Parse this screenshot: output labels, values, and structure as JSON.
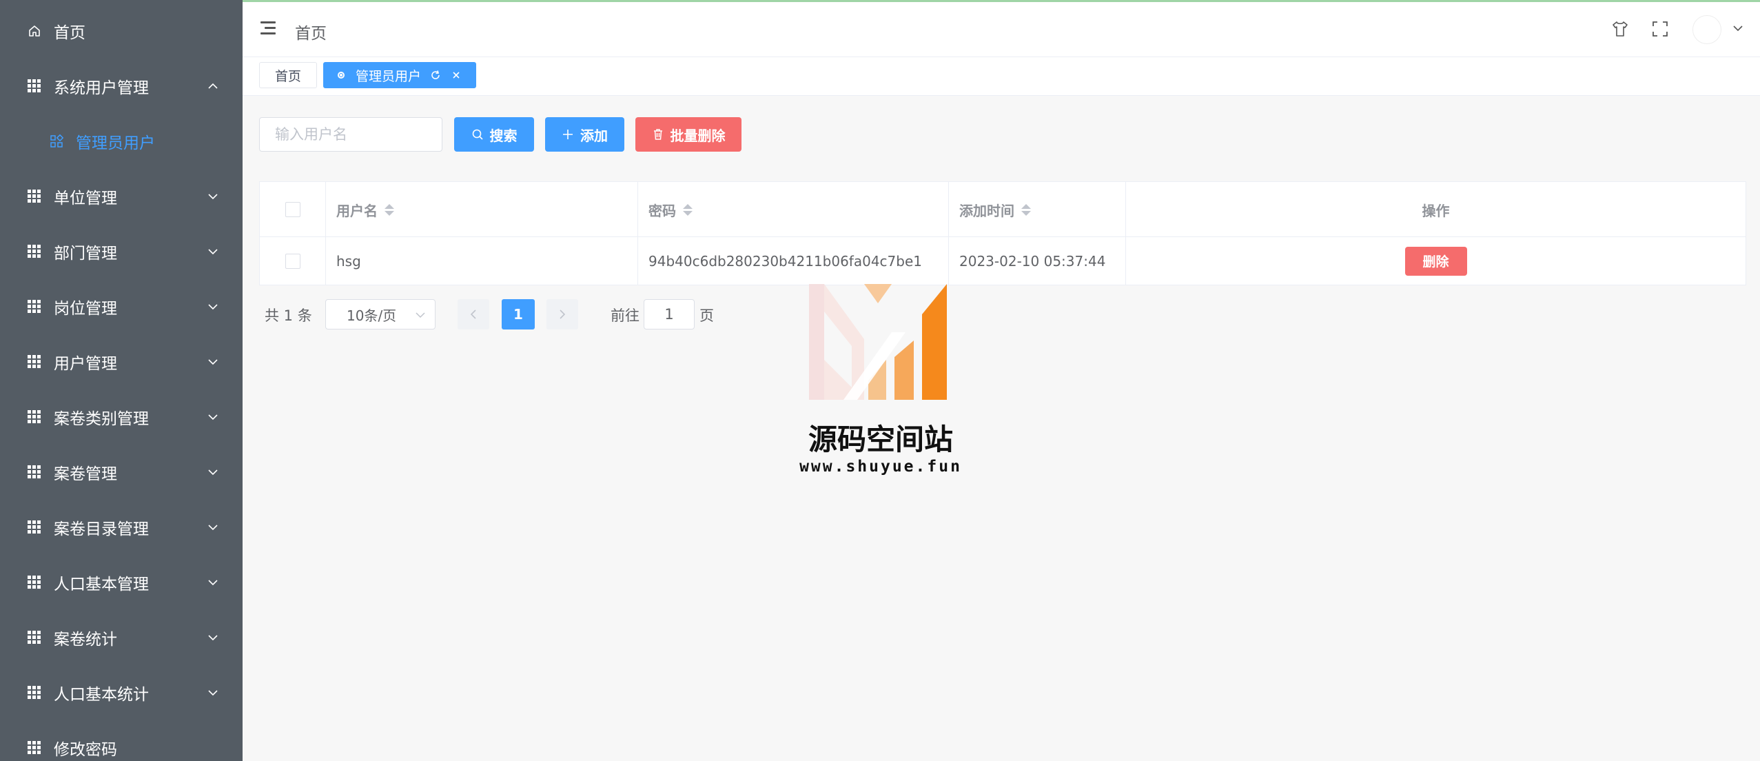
{
  "sidebar": {
    "items": [
      {
        "label": "首页",
        "icon": "home-icon"
      },
      {
        "label": "系统用户管理",
        "icon": "grid-icon",
        "expanded": true
      },
      {
        "label": "管理员用户",
        "icon": "apps-icon",
        "active": true
      },
      {
        "label": "单位管理",
        "icon": "grid-icon"
      },
      {
        "label": "部门管理",
        "icon": "grid-icon"
      },
      {
        "label": "岗位管理",
        "icon": "grid-icon"
      },
      {
        "label": "用户管理",
        "icon": "grid-icon"
      },
      {
        "label": "案卷类别管理",
        "icon": "grid-icon"
      },
      {
        "label": "案卷管理",
        "icon": "grid-icon"
      },
      {
        "label": "案卷目录管理",
        "icon": "grid-icon"
      },
      {
        "label": "人口基本管理",
        "icon": "grid-icon"
      },
      {
        "label": "案卷统计",
        "icon": "grid-icon"
      },
      {
        "label": "人口基本统计",
        "icon": "grid-icon"
      },
      {
        "label": "修改密码",
        "icon": "grid-icon"
      }
    ]
  },
  "header": {
    "breadcrumb": "首页",
    "icons": [
      "hamburger-icon",
      "shirt-icon",
      "fullscreen-icon",
      "avatar",
      "chevron-down-icon"
    ]
  },
  "tags": {
    "home": "首页",
    "active": "管理员用户"
  },
  "toolbar": {
    "search_placeholder": "输入用户名",
    "search_value": "",
    "search_label": "搜索",
    "add_label": "添加",
    "batch_delete_label": "批量删除"
  },
  "table": {
    "headers": {
      "username": "用户名",
      "password": "密码",
      "add_time": "添加时间",
      "action": "操作"
    },
    "rows": [
      {
        "username": "hsg",
        "password": "94b40c6db280230b4211b06fa04c7be1",
        "add_time": "2023-02-10 05:37:44",
        "action": "删除"
      }
    ]
  },
  "pagination": {
    "total": "共 1 条",
    "page_size": "10条/页",
    "current_page": "1",
    "goto_label": "前往",
    "goto_value": "1",
    "page_suffix": "页"
  },
  "watermark": {
    "title": "源码空间站",
    "url": "www.shuyue.fun"
  },
  "colors": {
    "sidebar_bg": "#545c64",
    "primary": "#409eff",
    "danger": "#f56c6c",
    "page_bg": "#f7f7f7"
  }
}
